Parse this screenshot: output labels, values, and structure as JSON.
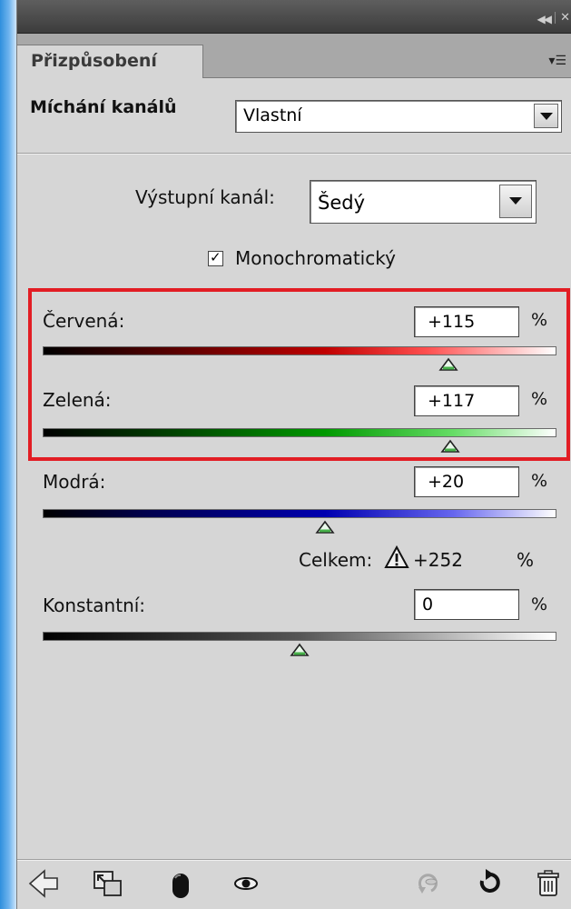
{
  "panel": {
    "tab_label": "Přizpůsobení",
    "collapse_icon": "double-chevron-left-icon",
    "menu_icon": "panel-menu-icon"
  },
  "preset": {
    "label": "Míchání kanálů",
    "value": "Vlastní"
  },
  "output_channel": {
    "label": "Výstupní kanál:",
    "value": "Šedý"
  },
  "monochrome": {
    "label": "Monochromatický",
    "checked": true
  },
  "channels": {
    "red": {
      "label": "Červená:",
      "value": "+115",
      "unit": "%",
      "slider_fraction": 0.79
    },
    "green": {
      "label": "Zelená:",
      "value": "+117",
      "unit": "%",
      "slider_fraction": 0.793
    },
    "blue": {
      "label": "Modrá:",
      "value": "+20",
      "unit": "%",
      "slider_fraction": 0.55
    }
  },
  "total": {
    "label": "Celkem:",
    "value": "+252",
    "unit": "%",
    "icon": "warning-icon"
  },
  "constant": {
    "label": "Konstantní:",
    "value": "0",
    "unit": "%",
    "slider_fraction": 0.5
  },
  "toolbar": {
    "icons": [
      "back-arrow-icon",
      "clip-to-layer-icon",
      "layer-mask-icon",
      "visibility-eye-icon",
      "view-previous-state-icon",
      "reset-icon",
      "trash-icon"
    ]
  },
  "colors": {
    "highlight": "#e21d24",
    "panel_bg": "#d6d6d6"
  }
}
